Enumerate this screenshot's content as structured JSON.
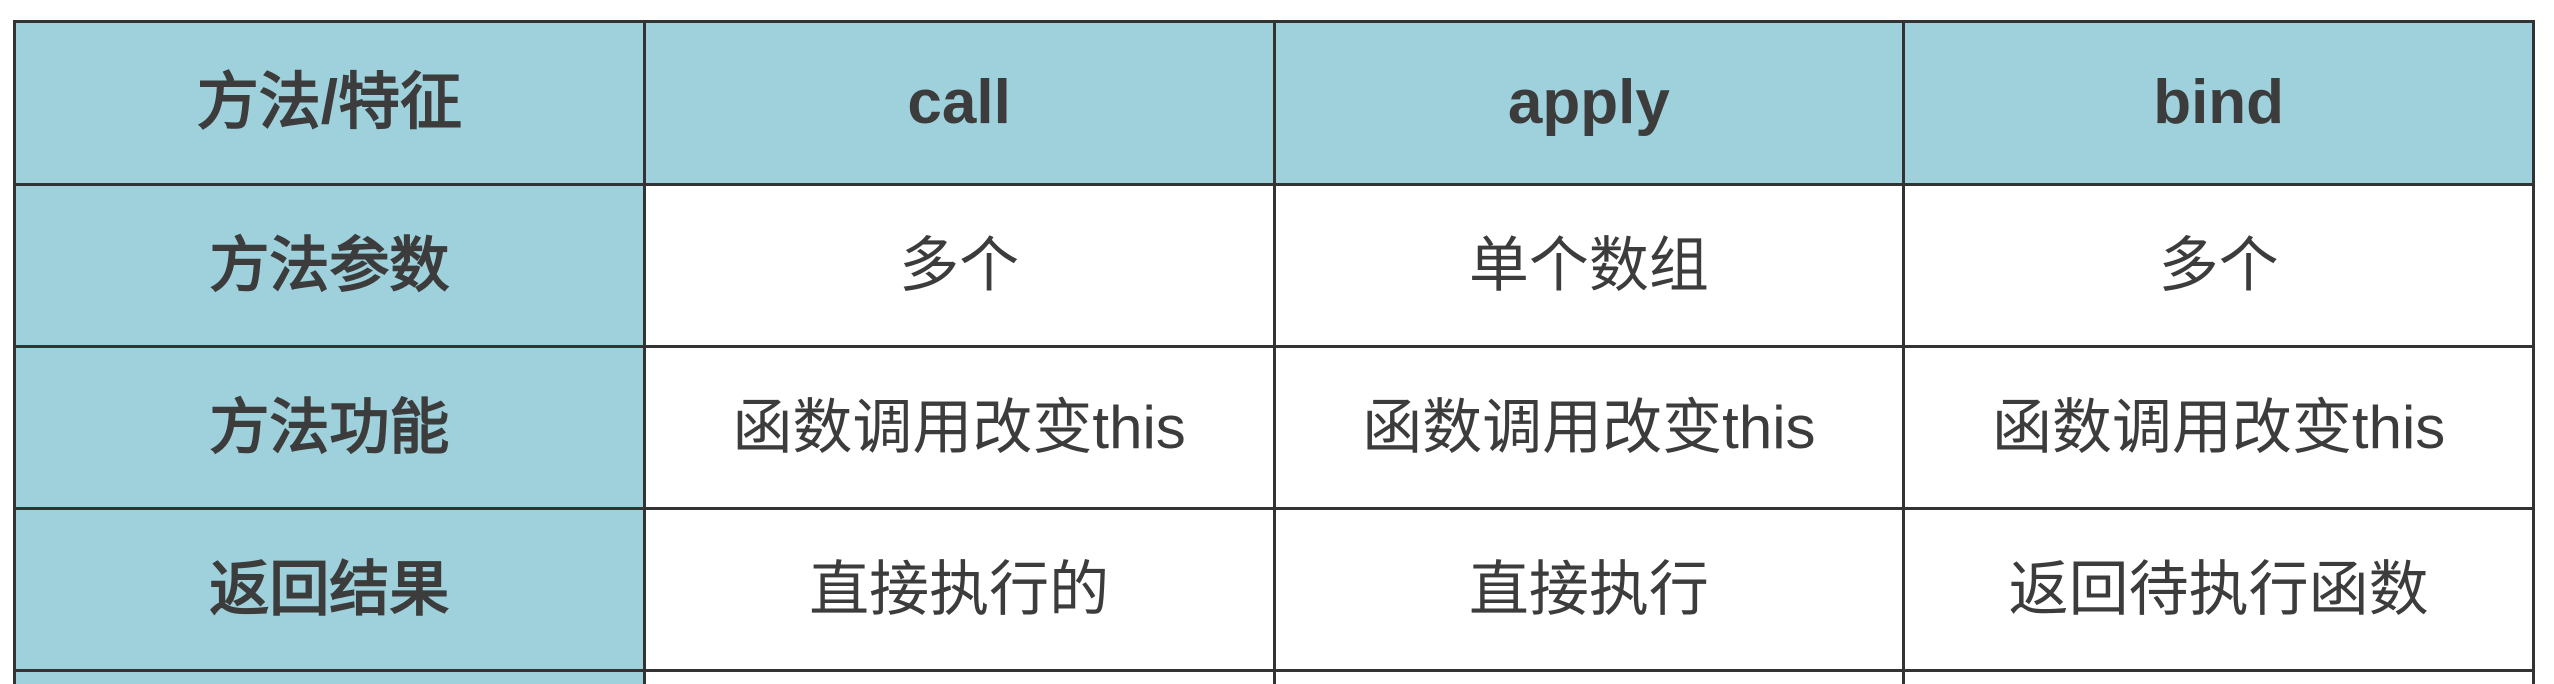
{
  "colors": {
    "header_bg": "#9ed1dc",
    "cell_bg": "#ffffff",
    "border": "#333333",
    "text": "#3c3c3c"
  },
  "table": {
    "header": {
      "corner": "方法/特征",
      "columns": [
        "call",
        "apply",
        "bind"
      ]
    },
    "rows": [
      {
        "label": "方法参数",
        "cells": [
          "多个",
          "单个数组",
          "多个"
        ]
      },
      {
        "label": "方法功能",
        "cells": [
          "函数调用改变this",
          "函数调用改变this",
          "函数调用改变this"
        ]
      },
      {
        "label": "返回结果",
        "cells": [
          "直接执行的",
          "直接执行",
          "返回待执行函数"
        ]
      }
    ]
  }
}
